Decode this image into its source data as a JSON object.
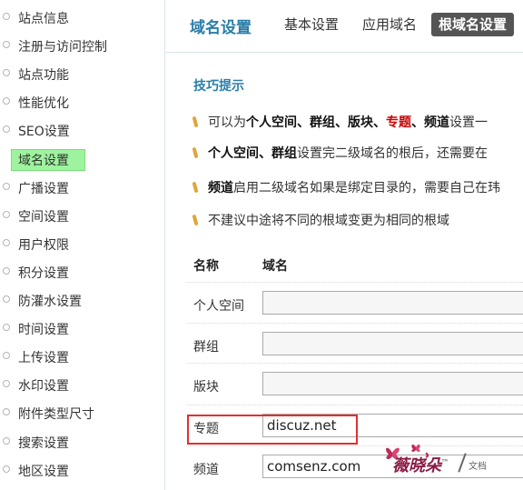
{
  "sidebar": {
    "items": [
      {
        "label": "站点信息"
      },
      {
        "label": "注册与访问控制"
      },
      {
        "label": "站点功能"
      },
      {
        "label": "性能优化"
      },
      {
        "label": "SEO设置"
      },
      {
        "label": "域名设置",
        "active": true
      },
      {
        "label": "广播设置"
      },
      {
        "label": "空间设置"
      },
      {
        "label": "用户权限"
      },
      {
        "label": "积分设置"
      },
      {
        "label": "防灌水设置"
      },
      {
        "label": "时间设置"
      },
      {
        "label": "上传设置"
      },
      {
        "label": "水印设置"
      },
      {
        "label": "附件类型尺寸"
      },
      {
        "label": "搜索设置"
      },
      {
        "label": "地区设置"
      }
    ]
  },
  "header": {
    "title": "域名设置",
    "tabs": [
      {
        "label": "基本设置"
      },
      {
        "label": "应用域名"
      },
      {
        "label": "根域名设置",
        "active": true
      }
    ]
  },
  "tips": {
    "title": "技巧提示",
    "items": [
      {
        "parts": [
          {
            "t": "可以为",
            "s": ""
          },
          {
            "t": "个人空间、群组、版块、",
            "s": "b"
          },
          {
            "t": "专题",
            "s": "red"
          },
          {
            "t": "、",
            "s": "b"
          },
          {
            "t": "频道",
            "s": "b"
          },
          {
            "t": "设置一",
            "s": ""
          }
        ]
      },
      {
        "parts": [
          {
            "t": "个人空间、群组",
            "s": "b"
          },
          {
            "t": "设置完二级域名的根后，还需要在",
            "s": ""
          }
        ]
      },
      {
        "parts": [
          {
            "t": "频道",
            "s": "b"
          },
          {
            "t": "启用二级域名如果是绑定目录的，需要自己在玮",
            "s": ""
          }
        ]
      },
      {
        "parts": [
          {
            "t": "不建议中途将不同的根域变更为相同的根域",
            "s": ""
          }
        ]
      }
    ]
  },
  "table": {
    "col_name": "名称",
    "col_domain": "域名",
    "rows": [
      {
        "label": "个人空间",
        "value": ""
      },
      {
        "label": "群组",
        "value": ""
      },
      {
        "label": "版块",
        "value": ""
      },
      {
        "label": "专题",
        "value": "discuz.net",
        "highlighted": true
      },
      {
        "label": "频道",
        "value": "comsenz.com"
      }
    ]
  },
  "watermark": {
    "text": "薇晓朵",
    "sub": "文档",
    "mark": "™"
  },
  "colors": {
    "accent": "#2a7ea8",
    "active_sidebar": "#9ef49e",
    "active_tab": "#555555",
    "highlight_border": "#e0302f",
    "tip_emphasis": "#cc0000"
  }
}
